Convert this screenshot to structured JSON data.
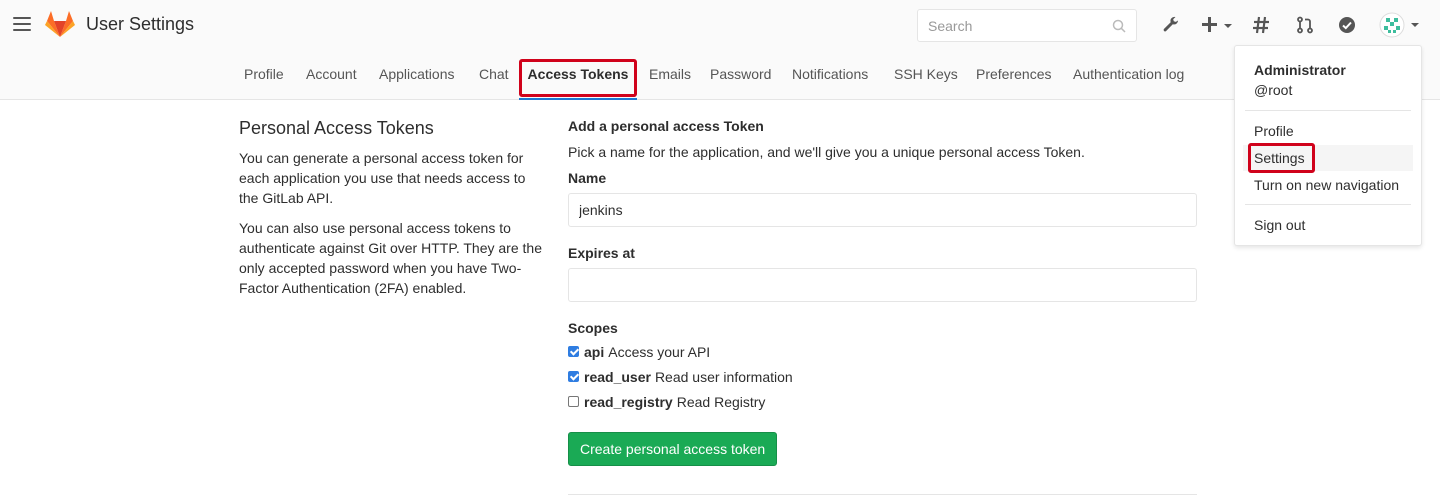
{
  "header": {
    "title": "User Settings",
    "search_placeholder": "Search"
  },
  "tabs": [
    {
      "label": "Profile"
    },
    {
      "label": "Account"
    },
    {
      "label": "Applications"
    },
    {
      "label": "Chat"
    },
    {
      "label": "Access Tokens",
      "active": true
    },
    {
      "label": "Emails"
    },
    {
      "label": "Password"
    },
    {
      "label": "Notifications"
    },
    {
      "label": "SSH Keys"
    },
    {
      "label": "Preferences"
    },
    {
      "label": "Authentication log"
    }
  ],
  "sidebar": {
    "heading": "Personal Access Tokens",
    "paragraph1": "You can generate a personal access token for each application you use that needs access to the GitLab API.",
    "paragraph2": "You can also use personal access tokens to authenticate against Git over HTTP. They are the only accepted password when you have Two-Factor Authentication (2FA) enabled."
  },
  "form": {
    "heading": "Add a personal access Token",
    "description": "Pick a name for the application, and we'll give you a unique personal access Token.",
    "name_label": "Name",
    "name_value": "jenkins",
    "expires_label": "Expires at",
    "expires_value": "",
    "scopes_label": "Scopes",
    "scopes": [
      {
        "name": "api",
        "description": "Access your API",
        "checked": true
      },
      {
        "name": "read_user",
        "description": "Read user information",
        "checked": true
      },
      {
        "name": "read_registry",
        "description": "Read Registry",
        "checked": false
      }
    ],
    "submit_label": "Create personal access token"
  },
  "user_dropdown": {
    "name": "Administrator",
    "username": "@root",
    "items": [
      {
        "label": "Profile"
      },
      {
        "label": "Settings"
      },
      {
        "label": "Turn on new navigation"
      },
      {
        "label": "Sign out"
      }
    ]
  },
  "colors": {
    "accent": "#1f78d1",
    "submit": "#1aaa55",
    "highlight": "#d0021b",
    "checkbox": "#2f7de1"
  }
}
